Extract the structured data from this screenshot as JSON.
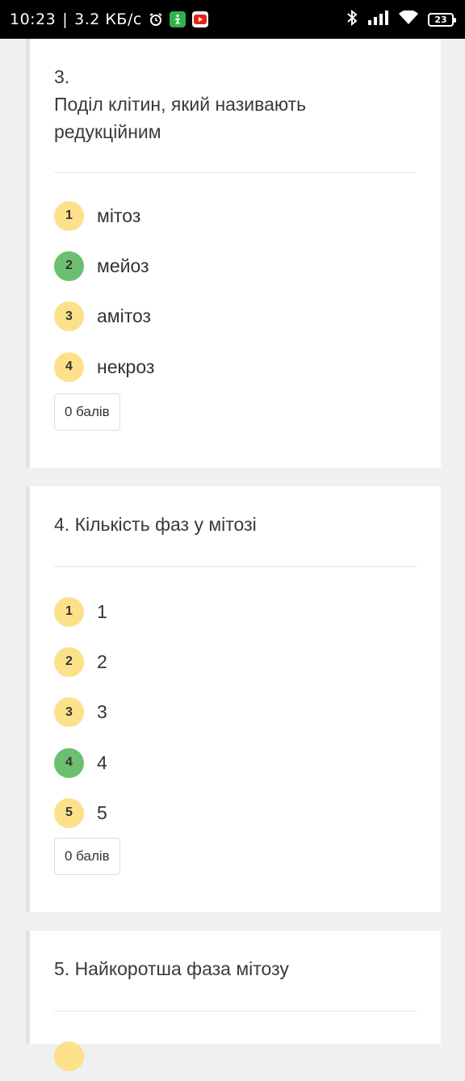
{
  "status_bar": {
    "time": "10:23",
    "separator": "|",
    "speed": "3.2 КБ/с",
    "battery": "23",
    "icons": [
      "alarm-icon",
      "app-green-icon",
      "youtube-icon",
      "bluetooth-icon",
      "signal-icon",
      "wifi-icon",
      "battery-icon"
    ]
  },
  "questions": [
    {
      "number": "3.",
      "text": "Поділ клітин, який називають редукційним",
      "options": [
        {
          "n": "1",
          "label": "мітоз",
          "correct": false
        },
        {
          "n": "2",
          "label": "мейоз",
          "correct": true
        },
        {
          "n": "3",
          "label": "амітоз",
          "correct": false
        },
        {
          "n": "4",
          "label": "некроз",
          "correct": false
        }
      ],
      "score": "0 балів"
    },
    {
      "title": "4. Кількість фаз у мітозі",
      "options": [
        {
          "n": "1",
          "label": "1",
          "correct": false
        },
        {
          "n": "2",
          "label": "2",
          "correct": false
        },
        {
          "n": "3",
          "label": "3",
          "correct": false
        },
        {
          "n": "4",
          "label": "4",
          "correct": true
        },
        {
          "n": "5",
          "label": "5",
          "correct": false
        }
      ],
      "score": "0 балів"
    },
    {
      "title": "5. Найкоротша фаза мітозу"
    }
  ],
  "colors": {
    "option_badge": "#fde08a",
    "correct_badge": "#6cbf6e",
    "page_bg": "#f0f0f0",
    "card_bg": "#ffffff"
  }
}
